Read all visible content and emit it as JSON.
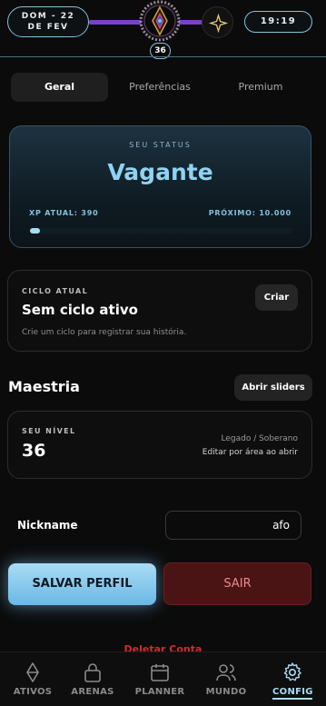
{
  "header": {
    "date_line1": "DOM - 22",
    "date_line2": "DE FEV",
    "time": "19:19",
    "level": "36"
  },
  "tabs": [
    {
      "label": "Geral",
      "active": true
    },
    {
      "label": "Preferências",
      "active": false
    },
    {
      "label": "Premium",
      "active": false
    }
  ],
  "status": {
    "label": "SEU STATUS",
    "name": "Vagante",
    "xp_label": "XP ATUAL: 390",
    "next_label": "PRÓXIMO: 10.000",
    "progress": 0.039
  },
  "ciclo": {
    "label": "CICLO ATUAL",
    "title": "Sem ciclo ativo",
    "description": "Crie um ciclo para registrar sua história.",
    "button": "Criar"
  },
  "maestria": {
    "title": "Maestria",
    "button": "Abrir sliders",
    "nivel_label": "SEU NÍVEL",
    "nivel_value": "36",
    "rank": "Legado / Soberano",
    "hint": "Editar por área ao abrir"
  },
  "nickname": {
    "label": "Nickname",
    "value": "afo"
  },
  "actions": {
    "save": "SALVAR PERFIL",
    "logout": "SAIR",
    "delete": "Deletar Conta"
  },
  "nav": [
    {
      "label": "ATIVOS",
      "icon": "diamond-icon"
    },
    {
      "label": "ARENAS",
      "icon": "lock-icon"
    },
    {
      "label": "PLANNER",
      "icon": "calendar-icon"
    },
    {
      "label": "MUNDO",
      "icon": "users-icon"
    },
    {
      "label": "CONFIG",
      "icon": "gear-icon",
      "active": true
    }
  ],
  "colors": {
    "accent": "#a7dcf5",
    "xp_bar": "#7b3fc9",
    "danger": "#d32b2b"
  }
}
